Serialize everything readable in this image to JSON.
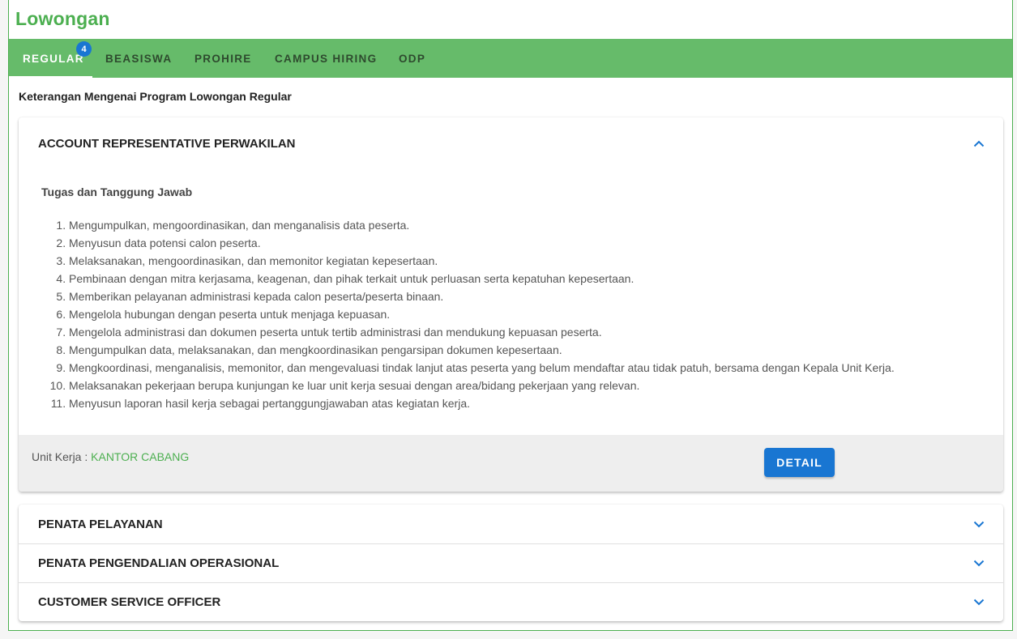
{
  "page": {
    "title": "Lowongan"
  },
  "tabs": [
    {
      "label": "REGULAR",
      "badge": "4"
    },
    {
      "label": "BEASISWA"
    },
    {
      "label": "PROHIRE"
    },
    {
      "label": "CAMPUS HIRING"
    },
    {
      "label": "ODP"
    }
  ],
  "description": "Keterangan Mengenai Program Lowongan Regular",
  "expanded_job": {
    "title": "ACCOUNT REPRESENTATIVE PERWAKILAN",
    "subheading": "Tugas dan Tanggung Jawab",
    "duties": [
      "Mengumpulkan, mengoordinasikan, dan menganalisis data peserta.",
      "Menyusun data potensi calon peserta.",
      "Melaksanakan, mengoordinasikan, dan memonitor kegiatan kepesertaan.",
      "Pembinaan dengan mitra kerjasama, keagenan, dan pihak terkait untuk perluasan serta kepatuhan kepesertaan.",
      "Memberikan pelayanan administrasi kepada calon peserta/peserta binaan.",
      "Mengelola hubungan dengan peserta untuk menjaga kepuasan.",
      "Mengelola administrasi dan dokumen peserta untuk tertib administrasi dan mendukung kepuasan peserta.",
      "Mengumpulkan data, melaksanakan, dan mengkoordinasikan pengarsipan dokumen kepesertaan.",
      "Mengkoordinasi, menganalisis, memonitor, dan mengevaluasi tindak lanjut atas peserta yang belum mendaftar atau tidak patuh, bersama dengan Kepala Unit Kerja.",
      "Melaksanakan pekerjaan berupa kunjungan ke luar unit kerja sesuai dengan area/bidang pekerjaan yang relevan.",
      "Menyusun laporan hasil kerja sebagai pertanggungjawaban atas kegiatan kerja."
    ],
    "unit_label": "Unit Kerja : ",
    "unit_value": "KANTOR CABANG",
    "detail_button": "DETAIL"
  },
  "collapsed_jobs": [
    {
      "title": "PENATA PELAYANAN"
    },
    {
      "title": "PENATA PENGENDALIAN OPERASIONAL"
    },
    {
      "title": "CUSTOMER SERVICE OFFICER"
    }
  ],
  "colors": {
    "brand_green": "#4caf50",
    "tab_bar": "#66bb6a",
    "accent_blue": "#1976d2"
  }
}
